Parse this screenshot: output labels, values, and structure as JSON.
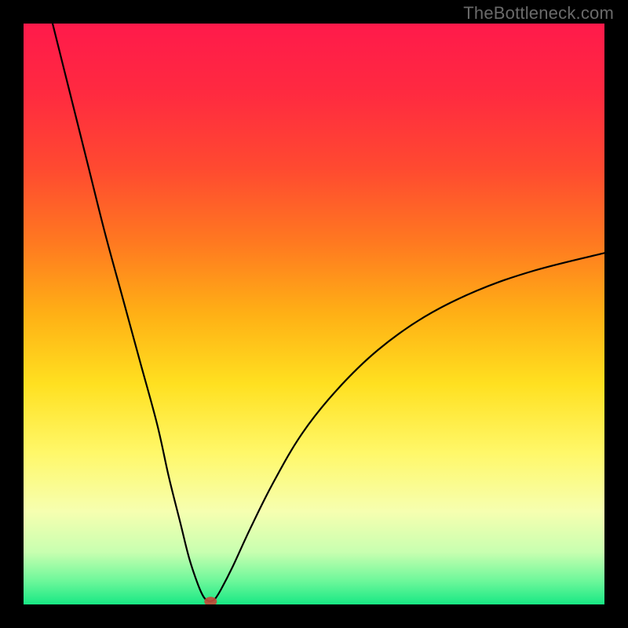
{
  "watermark": "TheBottleneck.com",
  "gradient": {
    "stops": [
      {
        "offset": 0.0,
        "color": "#ff1a4b"
      },
      {
        "offset": 0.12,
        "color": "#ff2a40"
      },
      {
        "offset": 0.25,
        "color": "#ff4a30"
      },
      {
        "offset": 0.38,
        "color": "#ff7a20"
      },
      {
        "offset": 0.5,
        "color": "#ffb015"
      },
      {
        "offset": 0.62,
        "color": "#ffe020"
      },
      {
        "offset": 0.74,
        "color": "#fff86a"
      },
      {
        "offset": 0.84,
        "color": "#f6ffb0"
      },
      {
        "offset": 0.91,
        "color": "#c8ffb0"
      },
      {
        "offset": 0.96,
        "color": "#6cf79a"
      },
      {
        "offset": 1.0,
        "color": "#18e884"
      }
    ]
  },
  "chart_data": {
    "type": "line",
    "title": "",
    "xlabel": "",
    "ylabel": "",
    "xlim": [
      0,
      100
    ],
    "ylim": [
      0,
      100
    ],
    "grid": false,
    "legend": false,
    "series": [
      {
        "name": "curve",
        "x": [
          5,
          8,
          11,
          14,
          17,
          20,
          23,
          25,
          27,
          28.5,
          30,
          31,
          31.8,
          32.4,
          33,
          34,
          36,
          39,
          43,
          48,
          54,
          61,
          69,
          78,
          88,
          100
        ],
        "y": [
          100,
          88,
          76,
          64,
          53,
          42,
          31,
          22,
          14,
          8,
          3.5,
          1.3,
          0.6,
          0.6,
          1.0,
          2.6,
          6.5,
          13,
          21,
          29.5,
          37,
          43.8,
          49.5,
          54,
          57.5,
          60.5
        ]
      }
    ],
    "marker": {
      "x": 32.2,
      "y": 0.5,
      "color": "#c14b3a",
      "rx": 1.2,
      "ry": 0.9
    },
    "flatspot": {
      "x0": 30.5,
      "x1": 33.0,
      "y": 0.6
    }
  }
}
